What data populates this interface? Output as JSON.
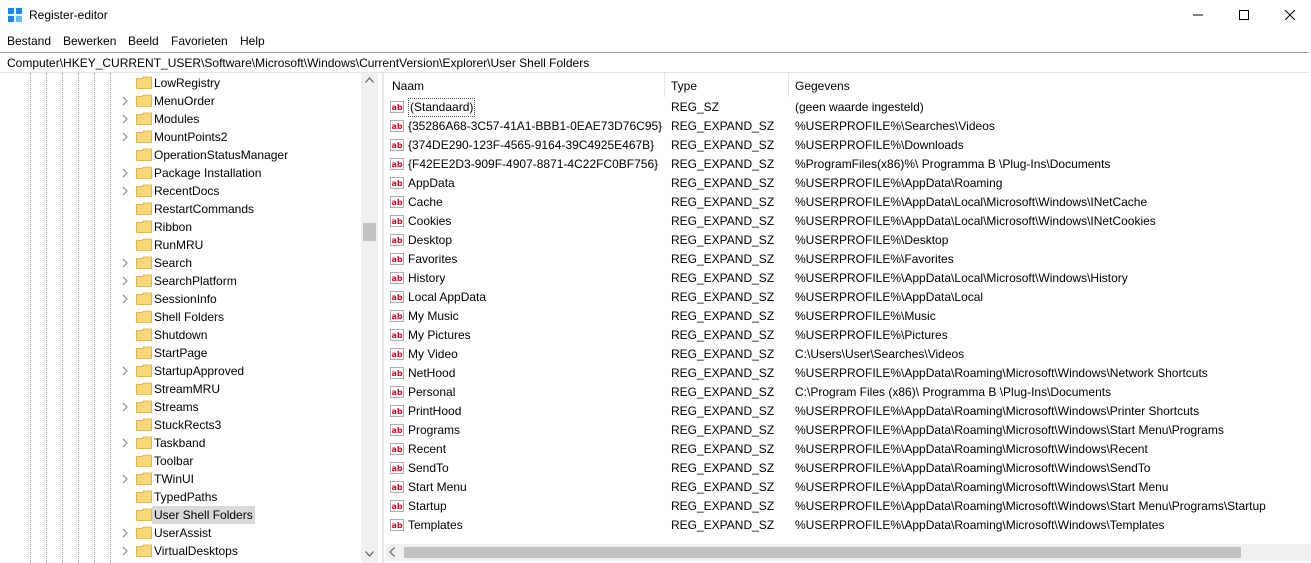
{
  "window": {
    "title": "Register-editor",
    "minimize_icon": "minimize-icon",
    "maximize_icon": "maximize-icon",
    "close_icon": "close-icon"
  },
  "menu": [
    "Bestand",
    "Bewerken",
    "Beeld",
    "Favorieten",
    "Help"
  ],
  "address": "Computer\\HKEY_CURRENT_USER\\Software\\Microsoft\\Windows\\CurrentVersion\\Explorer\\User Shell Folders",
  "tree": {
    "items": [
      {
        "label": "LowRegistry",
        "expandable": false,
        "selected": false
      },
      {
        "label": "MenuOrder",
        "expandable": true,
        "selected": false
      },
      {
        "label": "Modules",
        "expandable": true,
        "selected": false
      },
      {
        "label": "MountPoints2",
        "expandable": true,
        "selected": false
      },
      {
        "label": "OperationStatusManager",
        "expandable": false,
        "selected": false
      },
      {
        "label": "Package Installation",
        "expandable": true,
        "selected": false
      },
      {
        "label": "RecentDocs",
        "expandable": true,
        "selected": false
      },
      {
        "label": "RestartCommands",
        "expandable": false,
        "selected": false
      },
      {
        "label": "Ribbon",
        "expandable": false,
        "selected": false
      },
      {
        "label": "RunMRU",
        "expandable": false,
        "selected": false
      },
      {
        "label": "Search",
        "expandable": true,
        "selected": false
      },
      {
        "label": "SearchPlatform",
        "expandable": true,
        "selected": false
      },
      {
        "label": "SessionInfo",
        "expandable": true,
        "selected": false
      },
      {
        "label": "Shell Folders",
        "expandable": false,
        "selected": false
      },
      {
        "label": "Shutdown",
        "expandable": false,
        "selected": false
      },
      {
        "label": "StartPage",
        "expandable": false,
        "selected": false
      },
      {
        "label": "StartupApproved",
        "expandable": true,
        "selected": false
      },
      {
        "label": "StreamMRU",
        "expandable": false,
        "selected": false
      },
      {
        "label": "Streams",
        "expandable": true,
        "selected": false
      },
      {
        "label": "StuckRects3",
        "expandable": false,
        "selected": false
      },
      {
        "label": "Taskband",
        "expandable": true,
        "selected": false
      },
      {
        "label": "Toolbar",
        "expandable": false,
        "selected": false
      },
      {
        "label": "TWinUI",
        "expandable": true,
        "selected": false
      },
      {
        "label": "TypedPaths",
        "expandable": false,
        "selected": false
      },
      {
        "label": "User Shell Folders",
        "expandable": false,
        "selected": true
      },
      {
        "label": "UserAssist",
        "expandable": true,
        "selected": false
      },
      {
        "label": "VirtualDesktops",
        "expandable": true,
        "selected": false
      }
    ]
  },
  "columns": {
    "name": "Naam",
    "type": "Type",
    "data": "Gegevens"
  },
  "values": [
    {
      "name": "(Standaard)",
      "type": "REG_SZ",
      "data": "(geen waarde ingesteld)"
    },
    {
      "name": "{35286A68-3C57-41A1-BBB1-0EAE73D76C95}",
      "type": "REG_EXPAND_SZ",
      "data": "%USERPROFILE%\\Searches\\Videos"
    },
    {
      "name": "{374DE290-123F-4565-9164-39C4925E467B}",
      "type": "REG_EXPAND_SZ",
      "data": "%USERPROFILE%\\Downloads"
    },
    {
      "name": "{F42EE2D3-909F-4907-8871-4C22FC0BF756}",
      "type": "REG_EXPAND_SZ",
      "data": "%ProgramFiles(x86)%\\            Programma B            \\Plug-Ins\\Documents"
    },
    {
      "name": "AppData",
      "type": "REG_EXPAND_SZ",
      "data": "%USERPROFILE%\\AppData\\Roaming"
    },
    {
      "name": "Cache",
      "type": "REG_EXPAND_SZ",
      "data": "%USERPROFILE%\\AppData\\Local\\Microsoft\\Windows\\INetCache"
    },
    {
      "name": "Cookies",
      "type": "REG_EXPAND_SZ",
      "data": "%USERPROFILE%\\AppData\\Local\\Microsoft\\Windows\\INetCookies"
    },
    {
      "name": "Desktop",
      "type": "REG_EXPAND_SZ",
      "data": "%USERPROFILE%\\Desktop"
    },
    {
      "name": "Favorites",
      "type": "REG_EXPAND_SZ",
      "data": "%USERPROFILE%\\Favorites"
    },
    {
      "name": "History",
      "type": "REG_EXPAND_SZ",
      "data": "%USERPROFILE%\\AppData\\Local\\Microsoft\\Windows\\History"
    },
    {
      "name": "Local AppData",
      "type": "REG_EXPAND_SZ",
      "data": "%USERPROFILE%\\AppData\\Local"
    },
    {
      "name": "My Music",
      "type": "REG_EXPAND_SZ",
      "data": "%USERPROFILE%\\Music"
    },
    {
      "name": "My Pictures",
      "type": "REG_EXPAND_SZ",
      "data": "%USERPROFILE%\\Pictures"
    },
    {
      "name": "My Video",
      "type": "REG_EXPAND_SZ",
      "data": "C:\\Users\\User\\Searches\\Videos"
    },
    {
      "name": "NetHood",
      "type": "REG_EXPAND_SZ",
      "data": "%USERPROFILE%\\AppData\\Roaming\\Microsoft\\Windows\\Network Shortcuts"
    },
    {
      "name": "Personal",
      "type": "REG_EXPAND_SZ",
      "data": "C:\\Program Files (x86)\\            Programma B            \\Plug-Ins\\Documents"
    },
    {
      "name": "PrintHood",
      "type": "REG_EXPAND_SZ",
      "data": "%USERPROFILE%\\AppData\\Roaming\\Microsoft\\Windows\\Printer Shortcuts"
    },
    {
      "name": "Programs",
      "type": "REG_EXPAND_SZ",
      "data": "%USERPROFILE%\\AppData\\Roaming\\Microsoft\\Windows\\Start Menu\\Programs"
    },
    {
      "name": "Recent",
      "type": "REG_EXPAND_SZ",
      "data": "%USERPROFILE%\\AppData\\Roaming\\Microsoft\\Windows\\Recent"
    },
    {
      "name": "SendTo",
      "type": "REG_EXPAND_SZ",
      "data": "%USERPROFILE%\\AppData\\Roaming\\Microsoft\\Windows\\SendTo"
    },
    {
      "name": "Start Menu",
      "type": "REG_EXPAND_SZ",
      "data": "%USERPROFILE%\\AppData\\Roaming\\Microsoft\\Windows\\Start Menu"
    },
    {
      "name": "Startup",
      "type": "REG_EXPAND_SZ",
      "data": "%USERPROFILE%\\AppData\\Roaming\\Microsoft\\Windows\\Start Menu\\Programs\\Startup"
    },
    {
      "name": "Templates",
      "type": "REG_EXPAND_SZ",
      "data": "%USERPROFILE%\\AppData\\Roaming\\Microsoft\\Windows\\Templates"
    }
  ],
  "colors": {
    "folder": "#f8d775",
    "ab_icon": "#c8102e",
    "selected": "#d9d9d9"
  }
}
